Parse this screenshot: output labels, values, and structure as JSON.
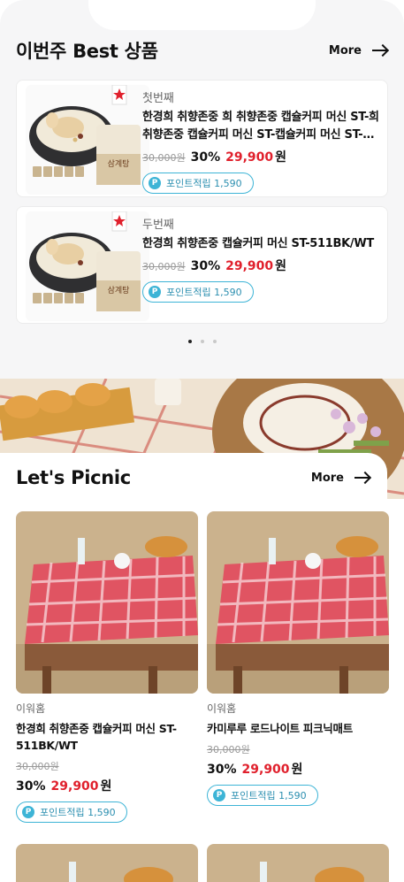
{
  "best": {
    "title": "이번주 Best 상품",
    "more": "More",
    "items": [
      {
        "rank": "첫번째",
        "name": "한경희 취향존중 희 취향존중 캡슐커피 머신 ST-희 취향존중 캡슐커피 머신 ST-캡슐커피 머신 ST-희 취향존중",
        "original_price": "30,000원",
        "discount": "30%",
        "price": "29,900",
        "currency": "원",
        "point_label": "포인트적립 1,590"
      },
      {
        "rank": "두번째",
        "name": "한경희 취향존중 캡슐커피 머신 ST-511BK/WT",
        "original_price": "30,000원",
        "discount": "30%",
        "price": "29,900",
        "currency": "원",
        "point_label": "포인트적립 1,590"
      }
    ],
    "pagination": {
      "current": 1,
      "total": 3
    }
  },
  "picnic": {
    "title": "Let's Picnic",
    "more": "More",
    "items": [
      {
        "brand": "이워홈",
        "name": "한경희 취향존중 캡슐커피 머신 ST-511BK/WT",
        "original_price": "30,000원",
        "discount": "30%",
        "price": "29,900",
        "currency": "원",
        "point_label": "포인트적립 1,590"
      },
      {
        "brand": "이워홈",
        "name": "카미루루 로드나이트 피크닉매트",
        "original_price": "30,000원",
        "discount": "30%",
        "price": "29,900",
        "currency": "원",
        "point_label": "포인트적립 1,590"
      }
    ]
  },
  "icons": {
    "more_arrow": "arrow-right-icon",
    "point_badge": "P"
  },
  "colors": {
    "sale": "#e0202c",
    "point": "#3db4d6",
    "background": "#f6f6f7"
  }
}
